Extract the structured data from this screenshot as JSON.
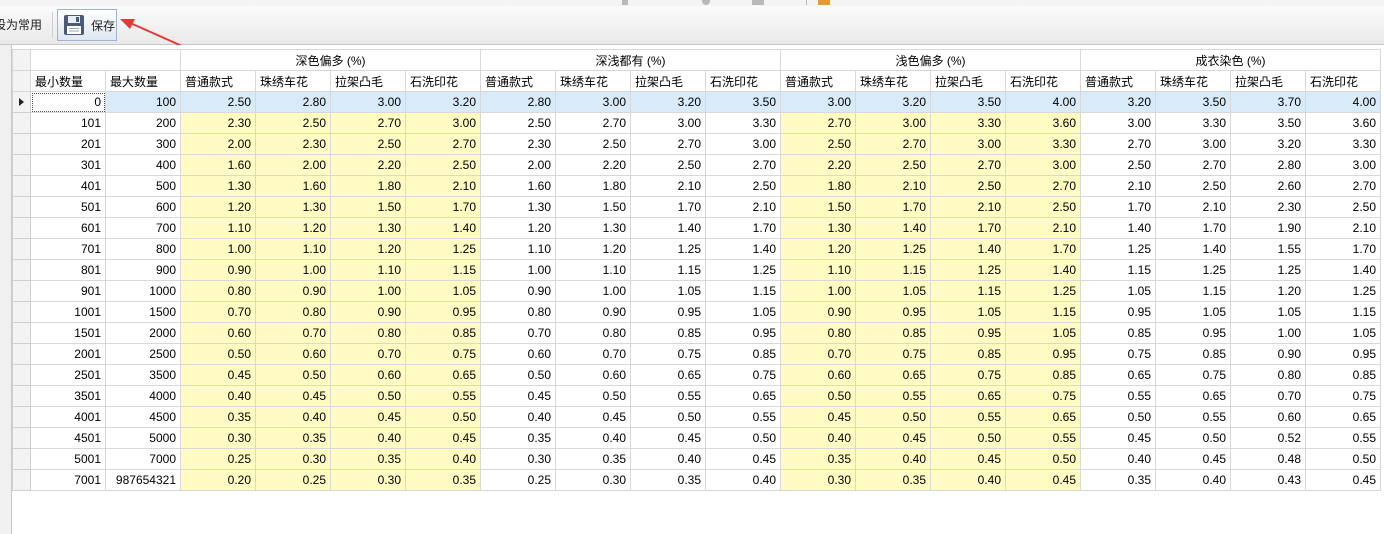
{
  "toolbar": {
    "set_default_label": "设为常用",
    "save_label": "保存",
    "annotation_arrow_color": "#e53935"
  },
  "grid": {
    "group_headers": [
      "深色偏多 (%)",
      "深浅都有 (%)",
      "浅色偏多 (%)",
      "成衣染色 (%)"
    ],
    "columns": [
      "最小数量",
      "最大数量",
      "普通款式",
      "珠绣车花",
      "拉架凸毛",
      "石洗印花",
      "普通款式",
      "珠绣车花",
      "拉架凸毛",
      "石洗印花",
      "普通款式",
      "珠绣车花",
      "拉架凸毛",
      "石洗印花",
      "普通款式",
      "珠绣车花",
      "拉架凸毛",
      "石洗印花"
    ],
    "selected_row": 0,
    "highlight_color": "#fffbc2",
    "selection_color": "#d9ebf8",
    "rows": [
      [
        "0",
        "100",
        "2.50",
        "2.80",
        "3.00",
        "3.20",
        "2.80",
        "3.00",
        "3.20",
        "3.50",
        "3.00",
        "3.20",
        "3.50",
        "4.00",
        "3.20",
        "3.50",
        "3.70",
        "4.00"
      ],
      [
        "101",
        "200",
        "2.30",
        "2.50",
        "2.70",
        "3.00",
        "2.50",
        "2.70",
        "3.00",
        "3.30",
        "2.70",
        "3.00",
        "3.30",
        "3.60",
        "3.00",
        "3.30",
        "3.50",
        "3.60"
      ],
      [
        "201",
        "300",
        "2.00",
        "2.30",
        "2.50",
        "2.70",
        "2.30",
        "2.50",
        "2.70",
        "3.00",
        "2.50",
        "2.70",
        "3.00",
        "3.30",
        "2.70",
        "3.00",
        "3.20",
        "3.30"
      ],
      [
        "301",
        "400",
        "1.60",
        "2.00",
        "2.20",
        "2.50",
        "2.00",
        "2.20",
        "2.50",
        "2.70",
        "2.20",
        "2.50",
        "2.70",
        "3.00",
        "2.50",
        "2.70",
        "2.80",
        "3.00"
      ],
      [
        "401",
        "500",
        "1.30",
        "1.60",
        "1.80",
        "2.10",
        "1.60",
        "1.80",
        "2.10",
        "2.50",
        "1.80",
        "2.10",
        "2.50",
        "2.70",
        "2.10",
        "2.50",
        "2.60",
        "2.70"
      ],
      [
        "501",
        "600",
        "1.20",
        "1.30",
        "1.50",
        "1.70",
        "1.30",
        "1.50",
        "1.70",
        "2.10",
        "1.50",
        "1.70",
        "2.10",
        "2.50",
        "1.70",
        "2.10",
        "2.30",
        "2.50"
      ],
      [
        "601",
        "700",
        "1.10",
        "1.20",
        "1.30",
        "1.40",
        "1.20",
        "1.30",
        "1.40",
        "1.70",
        "1.30",
        "1.40",
        "1.70",
        "2.10",
        "1.40",
        "1.70",
        "1.90",
        "2.10"
      ],
      [
        "701",
        "800",
        "1.00",
        "1.10",
        "1.20",
        "1.25",
        "1.10",
        "1.20",
        "1.25",
        "1.40",
        "1.20",
        "1.25",
        "1.40",
        "1.70",
        "1.25",
        "1.40",
        "1.55",
        "1.70"
      ],
      [
        "801",
        "900",
        "0.90",
        "1.00",
        "1.10",
        "1.15",
        "1.00",
        "1.10",
        "1.15",
        "1.25",
        "1.10",
        "1.15",
        "1.25",
        "1.40",
        "1.15",
        "1.25",
        "1.25",
        "1.40"
      ],
      [
        "901",
        "1000",
        "0.80",
        "0.90",
        "1.00",
        "1.05",
        "0.90",
        "1.00",
        "1.05",
        "1.15",
        "1.00",
        "1.05",
        "1.15",
        "1.25",
        "1.05",
        "1.15",
        "1.20",
        "1.25"
      ],
      [
        "1001",
        "1500",
        "0.70",
        "0.80",
        "0.90",
        "0.95",
        "0.80",
        "0.90",
        "0.95",
        "1.05",
        "0.90",
        "0.95",
        "1.05",
        "1.15",
        "0.95",
        "1.05",
        "1.05",
        "1.15"
      ],
      [
        "1501",
        "2000",
        "0.60",
        "0.70",
        "0.80",
        "0.85",
        "0.70",
        "0.80",
        "0.85",
        "0.95",
        "0.80",
        "0.85",
        "0.95",
        "1.05",
        "0.85",
        "0.95",
        "1.00",
        "1.05"
      ],
      [
        "2001",
        "2500",
        "0.50",
        "0.60",
        "0.70",
        "0.75",
        "0.60",
        "0.70",
        "0.75",
        "0.85",
        "0.70",
        "0.75",
        "0.85",
        "0.95",
        "0.75",
        "0.85",
        "0.90",
        "0.95"
      ],
      [
        "2501",
        "3500",
        "0.45",
        "0.50",
        "0.60",
        "0.65",
        "0.50",
        "0.60",
        "0.65",
        "0.75",
        "0.60",
        "0.65",
        "0.75",
        "0.85",
        "0.65",
        "0.75",
        "0.80",
        "0.85"
      ],
      [
        "3501",
        "4000",
        "0.40",
        "0.45",
        "0.50",
        "0.55",
        "0.45",
        "0.50",
        "0.55",
        "0.65",
        "0.50",
        "0.55",
        "0.65",
        "0.75",
        "0.55",
        "0.65",
        "0.70",
        "0.75"
      ],
      [
        "4001",
        "4500",
        "0.35",
        "0.40",
        "0.45",
        "0.50",
        "0.40",
        "0.45",
        "0.50",
        "0.55",
        "0.45",
        "0.50",
        "0.55",
        "0.65",
        "0.50",
        "0.55",
        "0.60",
        "0.65"
      ],
      [
        "4501",
        "5000",
        "0.30",
        "0.35",
        "0.40",
        "0.45",
        "0.35",
        "0.40",
        "0.45",
        "0.50",
        "0.40",
        "0.45",
        "0.50",
        "0.55",
        "0.45",
        "0.50",
        "0.52",
        "0.55"
      ],
      [
        "5001",
        "7000",
        "0.25",
        "0.30",
        "0.35",
        "0.40",
        "0.30",
        "0.35",
        "0.40",
        "0.45",
        "0.35",
        "0.40",
        "0.45",
        "0.50",
        "0.40",
        "0.45",
        "0.48",
        "0.50"
      ],
      [
        "7001",
        "987654321",
        "0.20",
        "0.25",
        "0.30",
        "0.35",
        "0.25",
        "0.30",
        "0.35",
        "0.40",
        "0.30",
        "0.35",
        "0.40",
        "0.45",
        "0.35",
        "0.40",
        "0.43",
        "0.45"
      ]
    ]
  }
}
